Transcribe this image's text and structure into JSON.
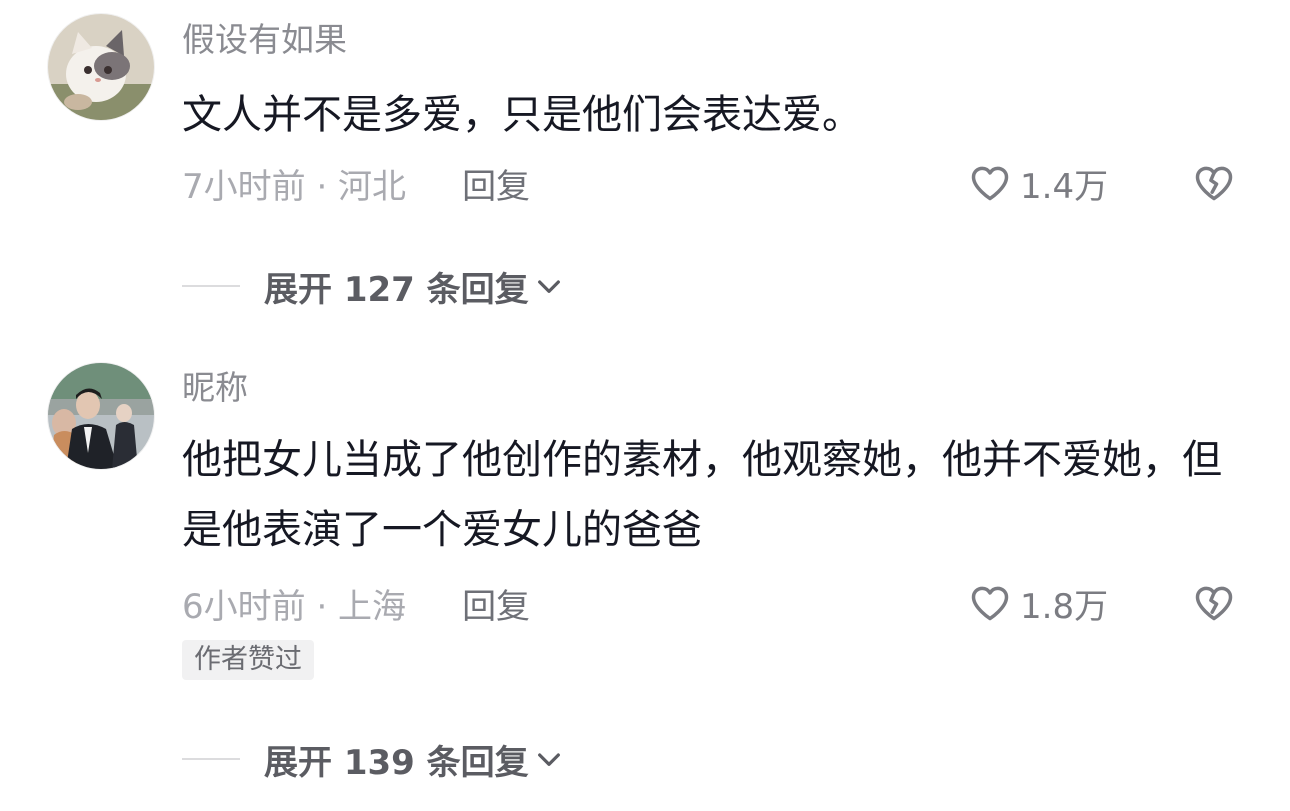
{
  "comments": [
    {
      "username": "假设有如果",
      "avatar_icon": "cat-avatar",
      "content": "文人并不是多爱，只是他们会表达爱。",
      "time_location": "7小时前 · 河北",
      "reply_label": "回复",
      "like_count": "1.4万",
      "author_badge": "",
      "expand_label": "展开 127 条回复"
    },
    {
      "username": "昵称",
      "avatar_icon": "person-photo-avatar",
      "content": "他把女儿当成了他创作的素材，他观察她，他并不爱她，但是他表演了一个爱女儿的爸爸",
      "time_location": "6小时前 · 上海",
      "reply_label": "回复",
      "like_count": "1.8万",
      "author_badge": "作者赞过",
      "expand_label": "展开 139 条回复"
    }
  ],
  "icons": {
    "like": "heart-outline-icon",
    "dislike": "broken-heart-icon",
    "expand": "chevron-down-icon"
  },
  "colors": {
    "text_primary": "#161823",
    "text_secondary": "#8a8b91",
    "badge_bg": "#f1f1f2",
    "icon_gray": "#7b7c82"
  }
}
